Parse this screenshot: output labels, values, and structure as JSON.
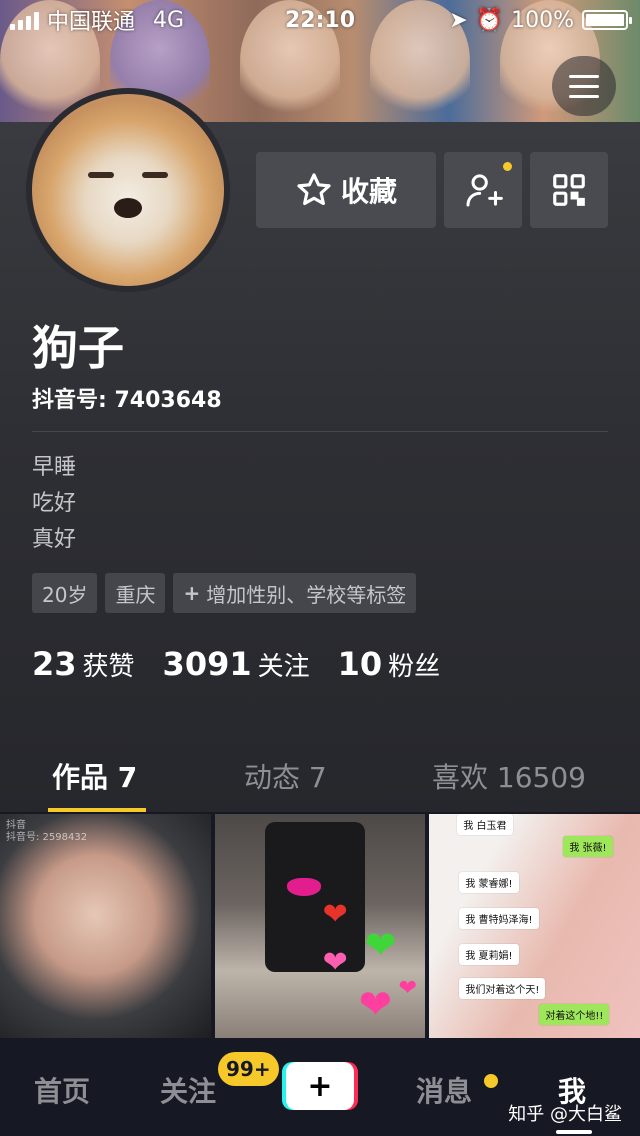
{
  "status_bar": {
    "carrier": "中国联通",
    "network": "4G",
    "time": "22:10",
    "battery": "100%",
    "battery_level": 1.0
  },
  "profile": {
    "favorite_label": "收藏",
    "name": "狗子",
    "douyin_id_label": "抖音号:",
    "douyin_id": "7403648",
    "bio": [
      "早睡",
      "吃好",
      "真好"
    ],
    "tags": [
      "20岁",
      "重庆",
      "增加性别、学校等标签"
    ]
  },
  "stats": [
    {
      "value": "23",
      "label": "获赞"
    },
    {
      "value": "3091",
      "label": "关注"
    },
    {
      "value": "10",
      "label": "粉丝"
    }
  ],
  "tabs": [
    {
      "label": "作品 7",
      "active": true
    },
    {
      "label": "动态 7",
      "active": false
    },
    {
      "label": "喜欢 16509",
      "active": false
    }
  ],
  "grid": {
    "cell1_watermark": "抖音",
    "cell1_watermark_id": "抖音号: 2598432",
    "chat": [
      "我 白玉君",
      "我 张薇!",
      "我 蒙睿娜!",
      "我 曹特妈泽海!",
      "我 夏莉娟!",
      "我们对着这个天!",
      "对着这个地!!"
    ]
  },
  "bottom_nav": {
    "home": "首页",
    "follow": "关注",
    "follow_badge": "99+",
    "plus": "+",
    "messages": "消息",
    "me": "我",
    "watermark": "知乎 @大白鲨"
  },
  "colors": {
    "accent": "#f7c82a",
    "background": "#161823",
    "card": "#4a4b50"
  }
}
